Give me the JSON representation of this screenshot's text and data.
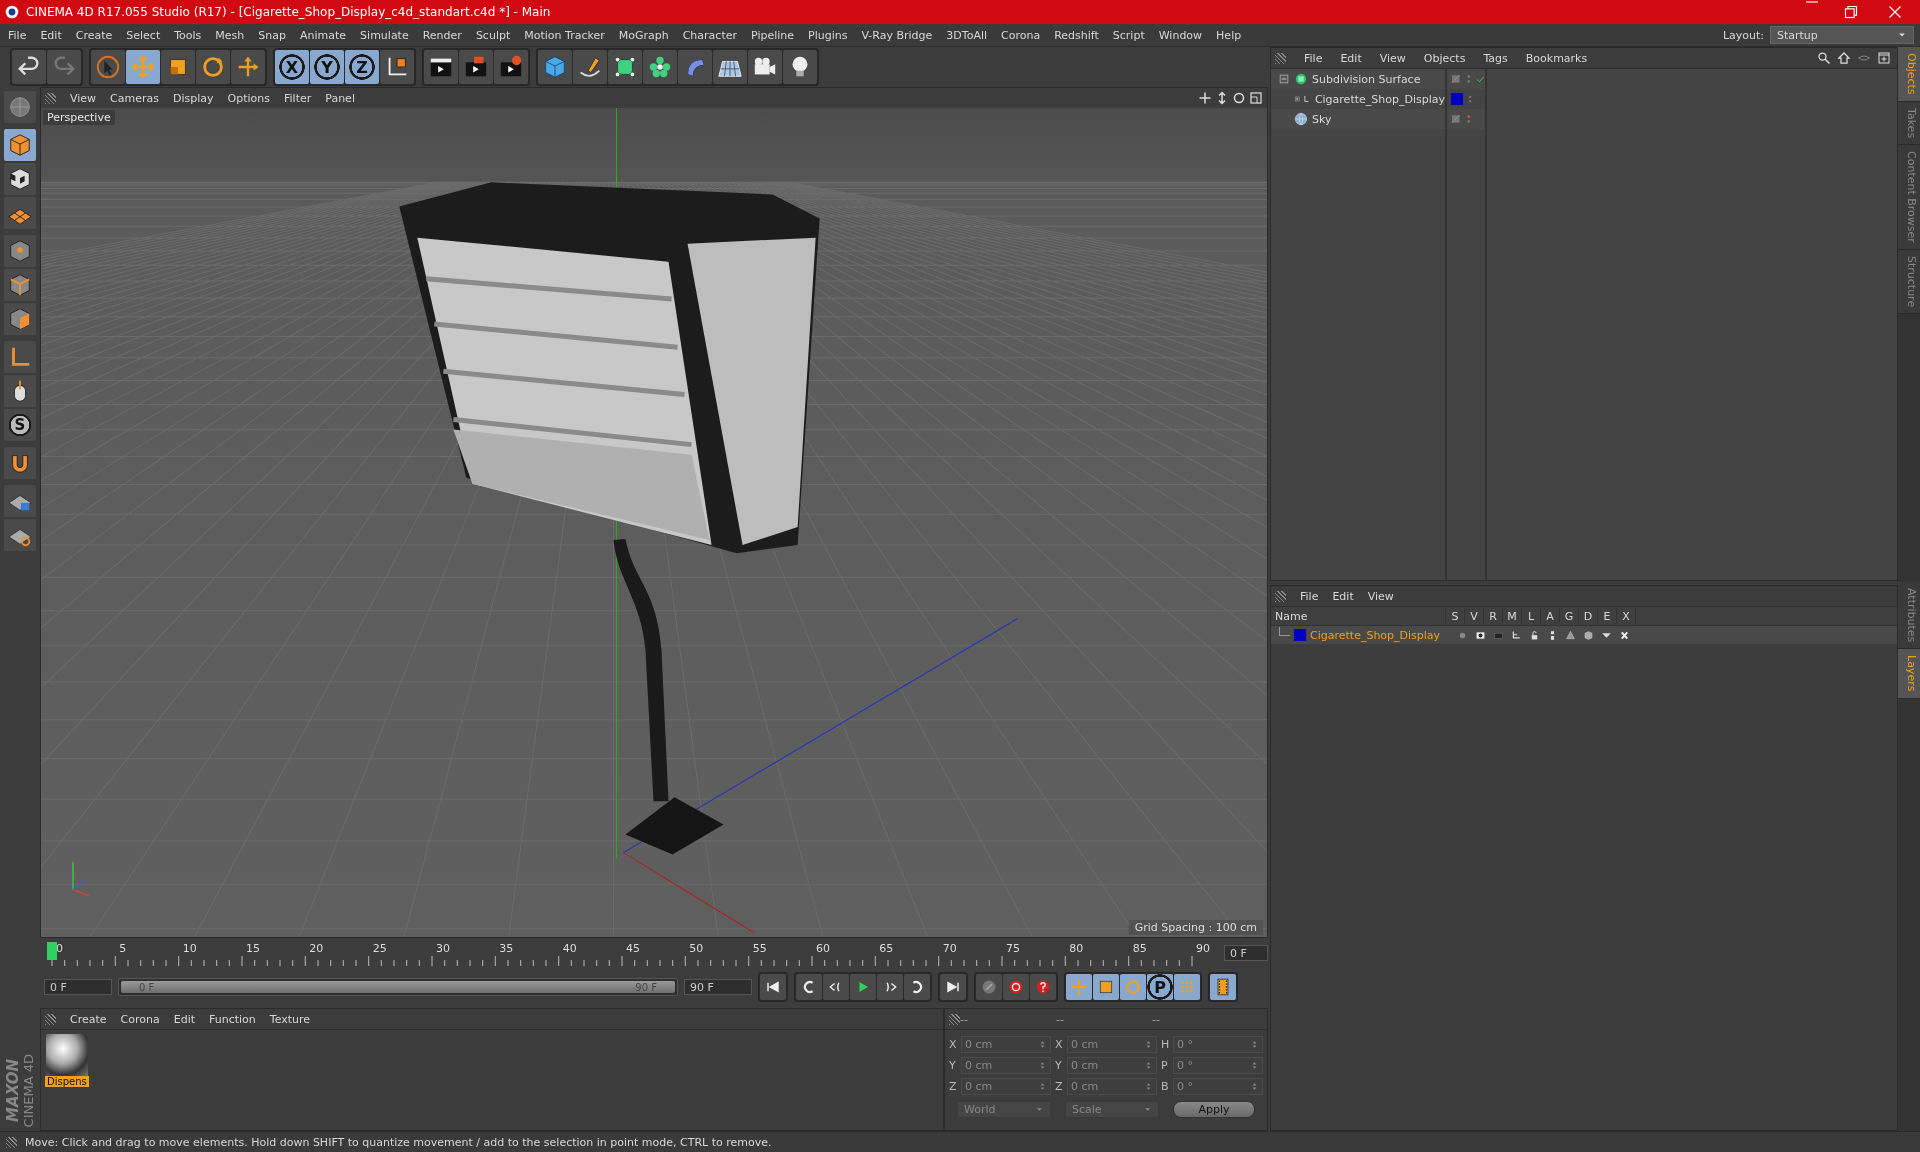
{
  "window": {
    "title": "CINEMA 4D R17.055 Studio (R17) - [Cigarette_Shop_Display_c4d_standart.c4d *] - Main"
  },
  "menu": [
    "File",
    "Edit",
    "Create",
    "Select",
    "Tools",
    "Mesh",
    "Snap",
    "Animate",
    "Simulate",
    "Render",
    "Sculpt",
    "Motion Tracker",
    "MoGraph",
    "Character",
    "Pipeline",
    "Plugins",
    "V-Ray Bridge",
    "3DToAll",
    "Corona",
    "Redshift",
    "Script",
    "Window",
    "Help"
  ],
  "layout": {
    "label": "Layout:",
    "value": "Startup"
  },
  "toolbar": [
    [
      {
        "kind": "undo",
        "selected": false
      },
      {
        "kind": "redo",
        "selected": false
      }
    ],
    [
      {
        "kind": "select",
        "selected": false
      },
      {
        "kind": "move",
        "selected": true
      },
      {
        "kind": "scale",
        "selected": false
      },
      {
        "kind": "rotate",
        "selected": false
      },
      {
        "kind": "transform",
        "selected": false
      }
    ],
    [
      {
        "kind": "axis",
        "label": "X",
        "selected": true
      },
      {
        "kind": "axis",
        "label": "Y",
        "selected": true
      },
      {
        "kind": "axis",
        "label": "Z",
        "selected": true
      },
      {
        "kind": "coords",
        "selected": false
      }
    ],
    [
      {
        "kind": "render-view",
        "selected": false
      },
      {
        "kind": "render",
        "selected": false
      },
      {
        "kind": "render-settings",
        "selected": false
      }
    ],
    [
      {
        "kind": "cube",
        "selected": false
      },
      {
        "kind": "pen",
        "selected": false
      },
      {
        "kind": "subdiv",
        "selected": false
      },
      {
        "kind": "cloner",
        "selected": false
      },
      {
        "kind": "deformer",
        "selected": false
      },
      {
        "kind": "floor",
        "selected": false
      },
      {
        "kind": "camera",
        "selected": false
      },
      {
        "kind": "light",
        "selected": false
      }
    ]
  ],
  "left_tools": [
    [
      {
        "kind": "editable",
        "selected": false
      }
    ],
    [
      {
        "kind": "model",
        "selected": true
      },
      {
        "kind": "checker",
        "selected": false
      },
      {
        "kind": "workplane",
        "selected": false
      }
    ],
    [
      {
        "kind": "points",
        "selected": false
      },
      {
        "kind": "edges",
        "selected": false
      },
      {
        "kind": "polygons",
        "selected": false
      }
    ],
    [
      {
        "kind": "axis-tool",
        "selected": false
      },
      {
        "kind": "tweak",
        "selected": false
      },
      {
        "kind": "snap",
        "label": "S",
        "selected": false
      }
    ],
    [
      {
        "kind": "magnet",
        "selected": false
      }
    ],
    [
      {
        "kind": "grid-lock",
        "selected": false
      },
      {
        "kind": "grid-snap",
        "selected": false
      }
    ]
  ],
  "brand": {
    "line1": "MAXON",
    "line2": "CINEMA 4D"
  },
  "viewport": {
    "menu": [
      "View",
      "Cameras",
      "Display",
      "Options",
      "Filter",
      "Panel"
    ],
    "camera": "Perspective",
    "grid_spacing": "Grid Spacing : 100 cm"
  },
  "timeline": {
    "ticks": [
      "0",
      "5",
      "10",
      "15",
      "20",
      "25",
      "30",
      "35",
      "40",
      "45",
      "50",
      "55",
      "60",
      "65",
      "70",
      "75",
      "80",
      "85",
      "90"
    ],
    "level": 0,
    "current": "0 F",
    "start": "0 F",
    "range": {
      "start": "0 F",
      "end": "90 F",
      "level": 1
    },
    "end": "90 F",
    "transport": [
      {
        "kind": "first",
        "selected": false
      },
      {
        "kind": "prev-key",
        "selected": false
      },
      {
        "kind": "prev-frame",
        "selected": false
      },
      {
        "kind": "play",
        "selected": false
      },
      {
        "kind": "next-frame",
        "selected": false
      },
      {
        "kind": "next-key",
        "selected": false
      },
      {
        "kind": "last",
        "selected": false
      }
    ],
    "record": [
      {
        "kind": "keyframe",
        "selected": false
      },
      {
        "kind": "record",
        "selected": false
      },
      {
        "kind": "autokey",
        "selected": false
      }
    ],
    "keys": [
      {
        "kind": "key-move",
        "selected": true
      },
      {
        "kind": "key-scale",
        "selected": true
      },
      {
        "kind": "key-rotate",
        "selected": true
      },
      {
        "kind": "key-param",
        "label": "P",
        "selected": true
      },
      {
        "kind": "key-points",
        "selected": true
      }
    ],
    "film": {
      "kind": "film",
      "selected": true
    }
  },
  "materials": {
    "menu": [
      "Create",
      "Corona",
      "Edit",
      "Function",
      "Texture"
    ],
    "items": [
      {
        "name": "Dispens",
        "selected": true
      }
    ]
  },
  "coordinates": {
    "headers": [
      "--",
      "--",
      "--"
    ],
    "rows": [
      [
        {
          "axis": "X",
          "value": "0 cm"
        },
        {
          "axis": "X",
          "value": "0 cm"
        },
        {
          "axis": "H",
          "value": "0 °"
        }
      ],
      [
        {
          "axis": "Y",
          "value": "0 cm"
        },
        {
          "axis": "Y",
          "value": "0 cm"
        },
        {
          "axis": "P",
          "value": "0 °"
        }
      ],
      [
        {
          "axis": "Z",
          "value": "0 cm"
        },
        {
          "axis": "Z",
          "value": "0 cm"
        },
        {
          "axis": "B",
          "value": "0 °"
        }
      ]
    ],
    "dropdowns": [
      "World",
      "Scale"
    ],
    "apply": "Apply"
  },
  "objects": {
    "menu": [
      "File",
      "Edit",
      "View",
      "Objects",
      "Tags",
      "Bookmarks"
    ],
    "items": [
      {
        "name": "Subdivision Surface",
        "kind": "subdiv",
        "expanded": true,
        "enabled": true,
        "editor_visible": true,
        "children": [
          {
            "name": "Cigarette_Shop_Display",
            "kind": "null",
            "expanded": false,
            "enabled": false,
            "editor_visible": true,
            "color": "#0000c0"
          }
        ]
      },
      {
        "name": "Sky",
        "kind": "sky",
        "expanded": false,
        "enabled": false,
        "editor_visible": false
      }
    ]
  },
  "layers": {
    "menu": [
      "File",
      "Edit",
      "View"
    ],
    "columns": [
      "Name",
      "S",
      "V",
      "R",
      "M",
      "L",
      "A",
      "G",
      "D",
      "E",
      "X"
    ],
    "items": [
      {
        "name": "Cigarette_Shop_Display",
        "color": "#0000c0"
      }
    ]
  },
  "side_tabs_top": [
    {
      "label": "Objects",
      "selected": true
    },
    {
      "label": "Takes",
      "selected": false
    },
    {
      "label": "Content Browser",
      "selected": false
    },
    {
      "label": "Structure",
      "selected": false
    }
  ],
  "side_tabs_bottom": [
    {
      "label": "Attributes",
      "selected": false
    },
    {
      "label": "Layers",
      "selected": true
    }
  ],
  "status": "Move: Click and drag to move elements. Hold down SHIFT to quantize movement / add to the selection in point mode, CTRL to remove."
}
